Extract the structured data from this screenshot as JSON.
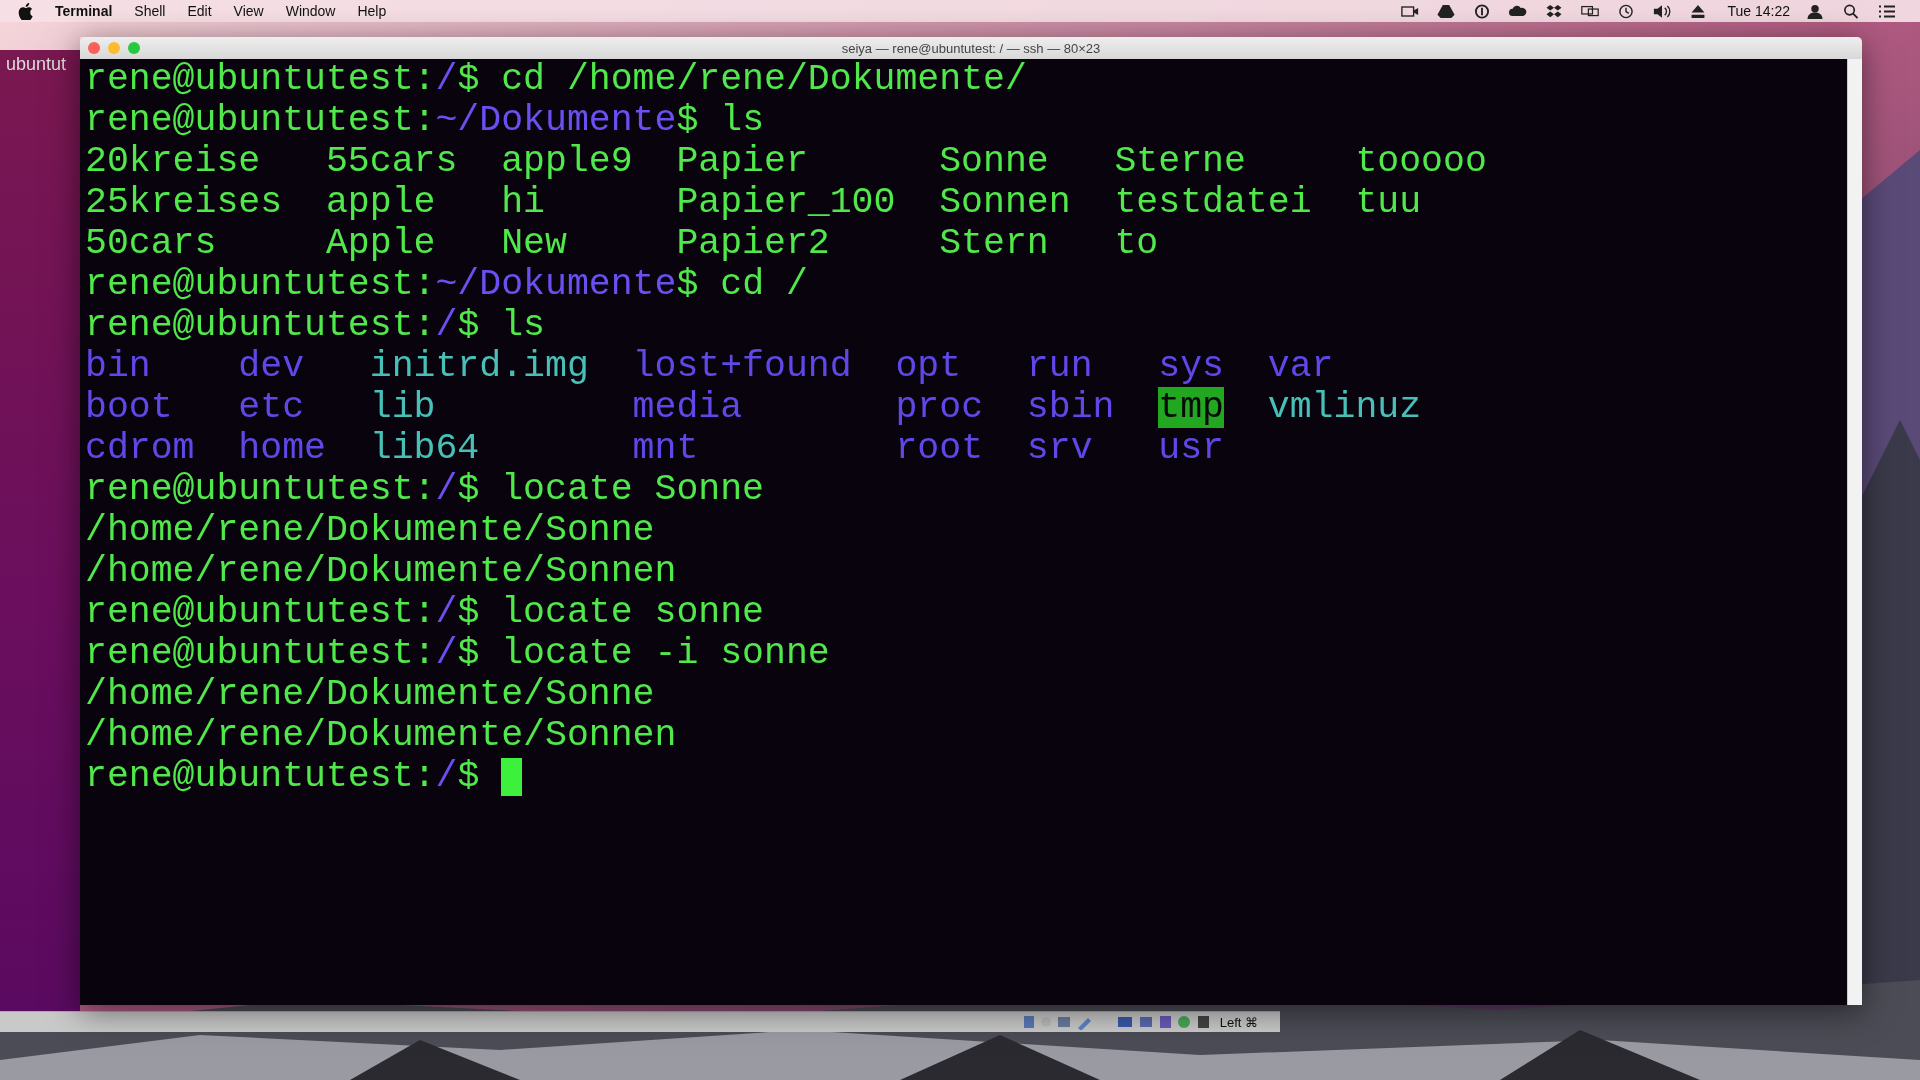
{
  "menu_bar": {
    "app": "Terminal",
    "items": [
      "Shell",
      "Edit",
      "View",
      "Window",
      "Help"
    ],
    "clock": "Tue 14:22"
  },
  "guest_label": "ubuntut",
  "window": {
    "title": "seiya — rene@ubuntutest: / — ssh — 80×23"
  },
  "terminal": {
    "lines": [
      {
        "kind": "prompt",
        "host": "rene@ubuntutest:",
        "path": "/",
        "command": "$ cd /home/rene/Dokumente/"
      },
      {
        "kind": "prompt",
        "host": "rene@ubuntutest:",
        "path": "~/Dokumente",
        "command": "$ ls"
      },
      {
        "kind": "listing",
        "rows": [
          [
            {
              "text": "20kreise",
              "kind": "file"
            },
            {
              "text": "55cars",
              "kind": "file"
            },
            {
              "text": "apple9",
              "kind": "file"
            },
            {
              "text": "Papier",
              "kind": "file"
            },
            {
              "text": "Sonne",
              "kind": "file"
            },
            {
              "text": "Sterne",
              "kind": "file"
            },
            {
              "text": "tooooo",
              "kind": "file"
            }
          ],
          [
            {
              "text": "25kreises",
              "kind": "file"
            },
            {
              "text": "apple",
              "kind": "file"
            },
            {
              "text": "hi",
              "kind": "file"
            },
            {
              "text": "Papier_100",
              "kind": "file"
            },
            {
              "text": "Sonnen",
              "kind": "file"
            },
            {
              "text": "testdatei",
              "kind": "file"
            },
            {
              "text": "tuu",
              "kind": "file"
            }
          ],
          [
            {
              "text": "50cars",
              "kind": "file"
            },
            {
              "text": "Apple",
              "kind": "file"
            },
            {
              "text": "New",
              "kind": "file"
            },
            {
              "text": "Papier2",
              "kind": "file"
            },
            {
              "text": "Stern",
              "kind": "file"
            },
            {
              "text": "to",
              "kind": "file"
            }
          ]
        ]
      },
      {
        "kind": "prompt",
        "host": "rene@ubuntutest:",
        "path": "~/Dokumente",
        "command": "$ cd /"
      },
      {
        "kind": "prompt",
        "host": "rene@ubuntutest:",
        "path": "/",
        "command": "$ ls"
      },
      {
        "kind": "listing",
        "rows": [
          [
            {
              "text": "bin",
              "kind": "dir"
            },
            {
              "text": "dev",
              "kind": "dir"
            },
            {
              "text": "initrd.img",
              "kind": "link"
            },
            {
              "text": "lost+found",
              "kind": "dir"
            },
            {
              "text": "opt",
              "kind": "dir"
            },
            {
              "text": "run",
              "kind": "dir"
            },
            {
              "text": "sys",
              "kind": "dir"
            },
            {
              "text": "var",
              "kind": "dir"
            }
          ],
          [
            {
              "text": "boot",
              "kind": "dir"
            },
            {
              "text": "etc",
              "kind": "dir"
            },
            {
              "text": "lib",
              "kind": "link"
            },
            {
              "text": "media",
              "kind": "dir"
            },
            {
              "text": "proc",
              "kind": "dir"
            },
            {
              "text": "sbin",
              "kind": "dir"
            },
            {
              "text": "tmp",
              "kind": "sticky"
            },
            {
              "text": "vmlinuz",
              "kind": "link"
            }
          ],
          [
            {
              "text": "cdrom",
              "kind": "dir"
            },
            {
              "text": "home",
              "kind": "dir"
            },
            {
              "text": "lib64",
              "kind": "link"
            },
            {
              "text": "mnt",
              "kind": "dir"
            },
            {
              "text": "root",
              "kind": "dir"
            },
            {
              "text": "srv",
              "kind": "dir"
            },
            {
              "text": "usr",
              "kind": "dir"
            }
          ]
        ]
      },
      {
        "kind": "prompt",
        "host": "rene@ubuntutest:",
        "path": "/",
        "command": "$ locate Sonne"
      },
      {
        "kind": "output",
        "text": "/home/rene/Dokumente/Sonne"
      },
      {
        "kind": "output",
        "text": "/home/rene/Dokumente/Sonnen"
      },
      {
        "kind": "prompt",
        "host": "rene@ubuntutest:",
        "path": "/",
        "command": "$ locate sonne"
      },
      {
        "kind": "prompt",
        "host": "rene@ubuntutest:",
        "path": "/",
        "command": "$ locate -i sonne"
      },
      {
        "kind": "output",
        "text": "/home/rene/Dokumente/Sonne"
      },
      {
        "kind": "output",
        "text": "/home/rene/Dokumente/Sonnen"
      },
      {
        "kind": "prompt",
        "host": "rene@ubuntutest:",
        "path": "/",
        "command": "$",
        "cursor": true
      }
    ]
  },
  "vm_status": {
    "host_key": "Left ⌘"
  }
}
